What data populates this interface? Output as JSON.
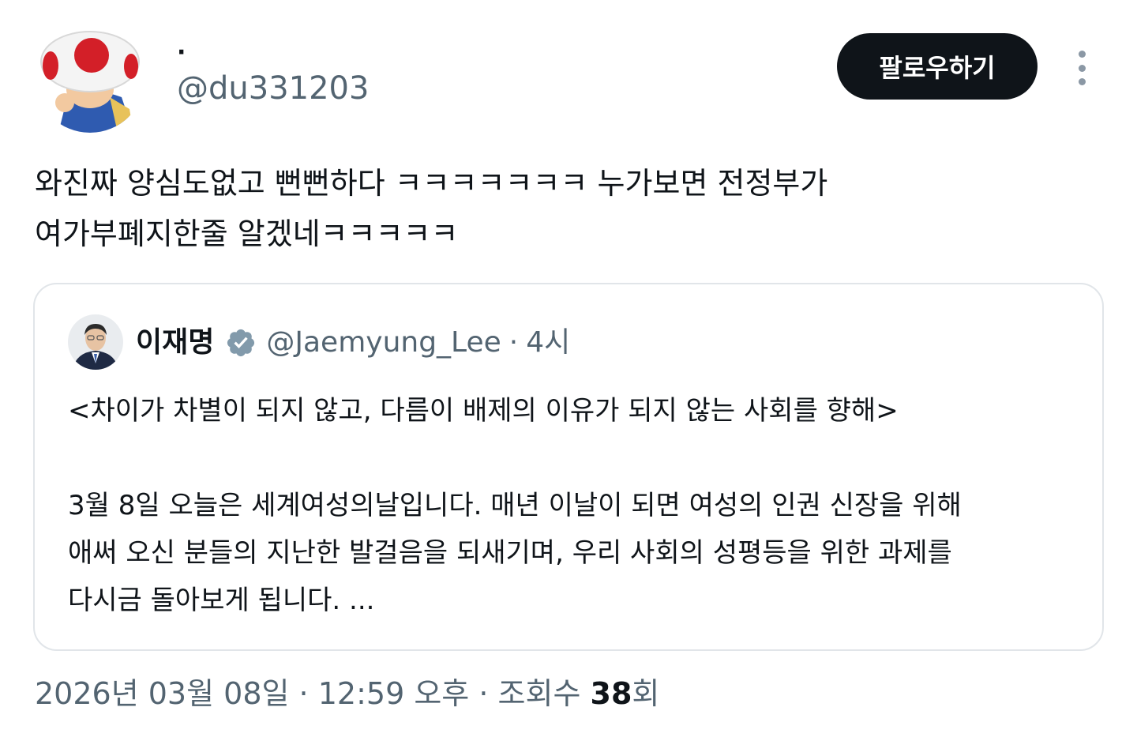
{
  "author": {
    "display_name": "·",
    "handle": "@du331203",
    "avatar": "mushroom-character-avatar"
  },
  "actions": {
    "follow_label": "팔로우하기",
    "more_icon": "more-vertical-icon"
  },
  "tweet": {
    "text": "와진짜 양심도없고 뻔뻔하다 ㅋㅋㅋㅋㅋㅋㅋ 누가보면 전정부가\n여가부폐지한줄 알겠네ㅋㅋㅋㅋㅋ"
  },
  "quote": {
    "author_name": "이재명",
    "verified_icon": "verified-badge-icon",
    "handle": "@Jaemyung_Lee",
    "separator": "·",
    "time": "4시",
    "title": "<차이가 차별이 되지 않고, 다름이 배제의 이유가 되지 않는 사회를 향해>",
    "body_lines": [
      "3월 8일 오늘은 세계여성의날입니다. 매년 이날이 되면 여성의 인권 신장을 위해",
      "애써 오신 분들의 지난한 발걸음을 되새기며, 우리 사회의 성평등을 위한 과제를",
      "다시금 돌아보게 됩니다.  ..."
    ]
  },
  "meta": {
    "date": "2026년 03월 08일",
    "sep1": "·",
    "time": "12:59 오후",
    "sep2": "·",
    "views_label": "조회수",
    "views_count": "38",
    "views_unit": "회"
  },
  "colors": {
    "text": "#0f1419",
    "secondary": "#536471",
    "button_bg": "#0f1419",
    "verified": "#829aab",
    "border": "#e1e5e9"
  }
}
